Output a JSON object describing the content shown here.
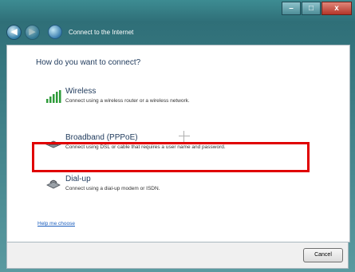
{
  "window": {
    "controls": {
      "minimize": "–",
      "maximize": "□",
      "close": "x"
    }
  },
  "nav": {
    "back": "◀",
    "forward": "▶",
    "title": "Connect to the Internet"
  },
  "main": {
    "heading": "How do you want to connect?",
    "options": [
      {
        "icon": "wireless-signal-icon",
        "title": "Wireless",
        "desc": "Connect using a wireless router or a wireless network."
      },
      {
        "icon": "broadband-modem-icon",
        "title": "Broadband (PPPoE)",
        "desc": "Connect using DSL or cable that requires a user name and password."
      },
      {
        "icon": "dialup-modem-icon",
        "title": "Dial-up",
        "desc": "Connect using a dial-up modem or ISDN."
      }
    ],
    "help_link": "Help me choose"
  },
  "footer": {
    "cancel_label": "Cancel"
  },
  "colors": {
    "highlight": "#e00000",
    "heading": "#1e395b",
    "link": "#1a5dbd"
  }
}
